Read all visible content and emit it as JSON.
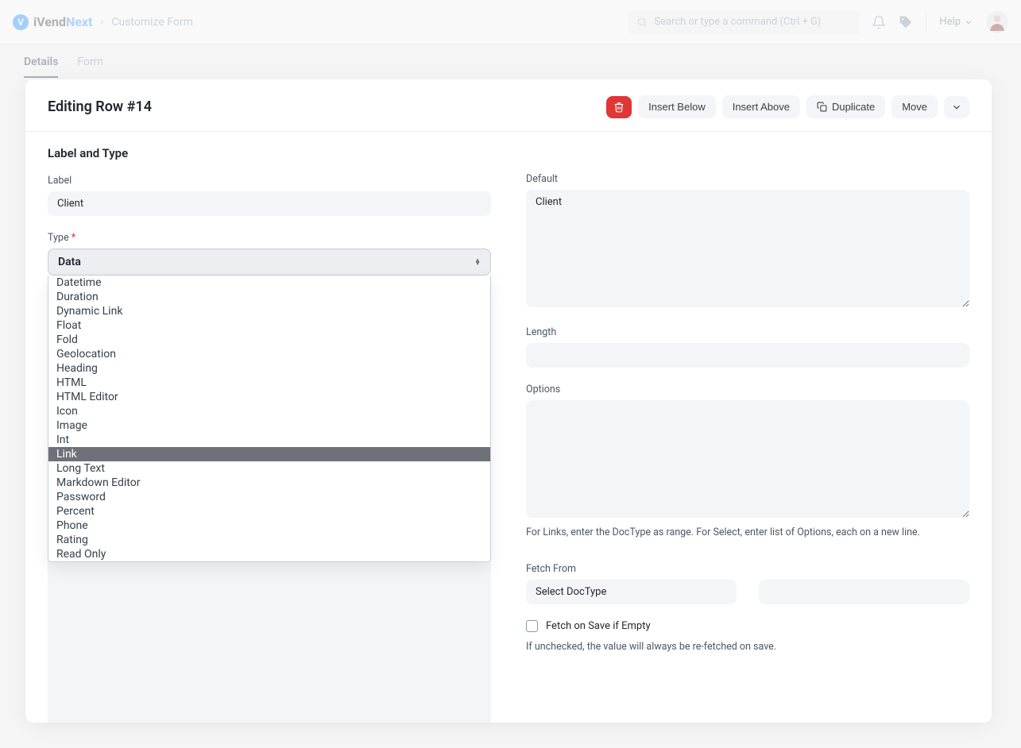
{
  "brand": {
    "logo_letter": "V",
    "name_main": "iVend",
    "name_accent": "Next"
  },
  "breadcrumb": {
    "page": "Customize Form"
  },
  "topbar": {
    "search_placeholder": "Search or type a command (Ctrl + G)",
    "help_label": "Help"
  },
  "tabs": {
    "details": "Details",
    "form": "Form"
  },
  "modal": {
    "title": "Editing Row #14",
    "actions": {
      "insert_below": "Insert Below",
      "insert_above": "Insert Above",
      "duplicate": "Duplicate",
      "move": "Move"
    }
  },
  "section": {
    "label_and_type": "Label and Type"
  },
  "left": {
    "label_label": "Label",
    "label_value": "Client",
    "type_label": "Type",
    "type_value": "Data",
    "type_options": [
      "Datetime",
      "Duration",
      "Dynamic Link",
      "Float",
      "Fold",
      "Geolocation",
      "Heading",
      "HTML",
      "HTML Editor",
      "Icon",
      "Image",
      "Int",
      "Link",
      "Long Text",
      "Markdown Editor",
      "Password",
      "Percent",
      "Phone",
      "Rating",
      "Read Only"
    ],
    "type_highlighted": "Link"
  },
  "right": {
    "default_label": "Default",
    "default_value": "Client",
    "length_label": "Length",
    "length_value": "",
    "options_label": "Options",
    "options_value": "",
    "options_help": "For Links, enter the DocType as range. For Select, enter list of Options, each on a new line.",
    "fetch_from_label": "Fetch From",
    "fetch_from_placeholder": "Select DocType",
    "fetch_on_save_label": "Fetch on Save if Empty",
    "fetch_help": "If unchecked, the value will always be re-fetched on save."
  }
}
